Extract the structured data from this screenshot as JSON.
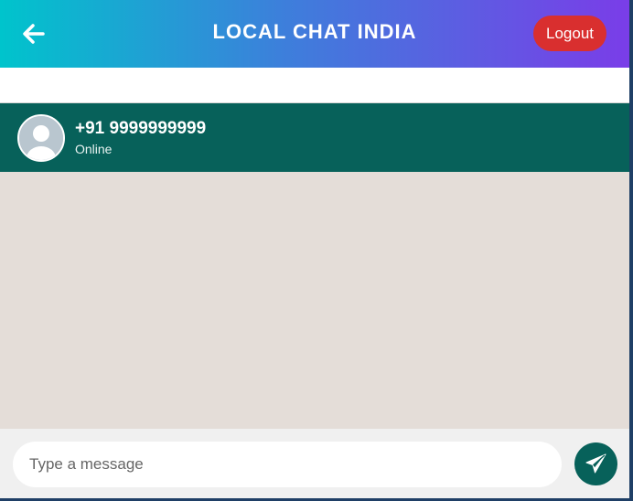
{
  "header": {
    "title": "LOCAL CHAT INDIA",
    "logout_label": "Logout",
    "back_icon": "arrow-left-icon"
  },
  "contact": {
    "name": "+91 9999999999",
    "status": "Online",
    "avatar_icon": "user-avatar-icon"
  },
  "composer": {
    "placeholder": "Type a message",
    "value": "",
    "send_icon": "paper-plane-icon"
  },
  "colors": {
    "header_gradient": [
      "#00c4cc",
      "#3d7fdb",
      "#7a3de8"
    ],
    "logout": "#d92f2f",
    "contact_bar": "#07615a",
    "chat_background": "#e4ddd8",
    "send_button": "#07615a"
  }
}
